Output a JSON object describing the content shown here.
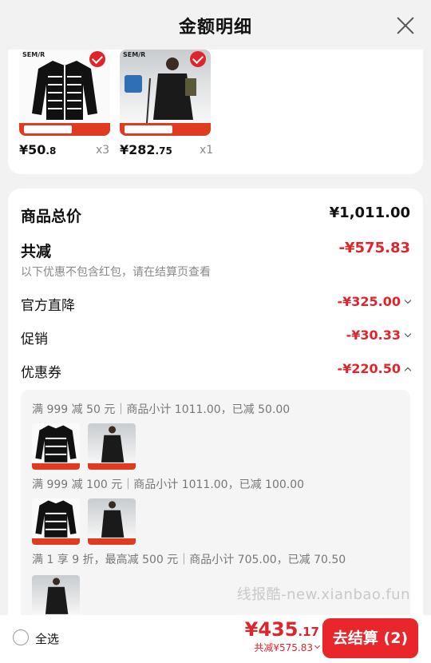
{
  "header": {
    "title": "金额明细"
  },
  "products": [
    {
      "brand": "SEM/R",
      "price_main": "¥50",
      "price_decimal": ".8",
      "qty": "x3"
    },
    {
      "brand": "SEM/R",
      "price_main": "¥282",
      "price_decimal": ".75",
      "qty": "x1"
    }
  ],
  "summary": {
    "total_label": "商品总价",
    "total_value": "¥1,011.00",
    "discount_label": "共减",
    "discount_value": "-¥575.83",
    "discount_note": "以下优惠不包含红包，请在结算页查看",
    "items": [
      {
        "label": "官方直降",
        "value": "-¥325.00"
      },
      {
        "label": "促销",
        "value": "-¥30.33"
      },
      {
        "label": "优惠券",
        "value": "-¥220.50"
      }
    ]
  },
  "coupons": [
    {
      "text": "满 999 减 50 元｜商品小计 1011.00，已减 50.00"
    },
    {
      "text": "满 999 减 100 元｜商品小计 1011.00，已减 100.00"
    },
    {
      "text": "满 1 享 9 折，最高减 500 元｜商品小计 705.00，已减 70.50"
    }
  ],
  "watermark": "线报酷-new.xianbao.fun",
  "bottom": {
    "select_all": "全选",
    "total_main": "¥435",
    "total_decimal": ".17",
    "total_sub": "共减¥575.83",
    "checkout": "去结算 (2)"
  },
  "colors": {
    "accent": "#e0242a",
    "button": "#e8262c"
  }
}
